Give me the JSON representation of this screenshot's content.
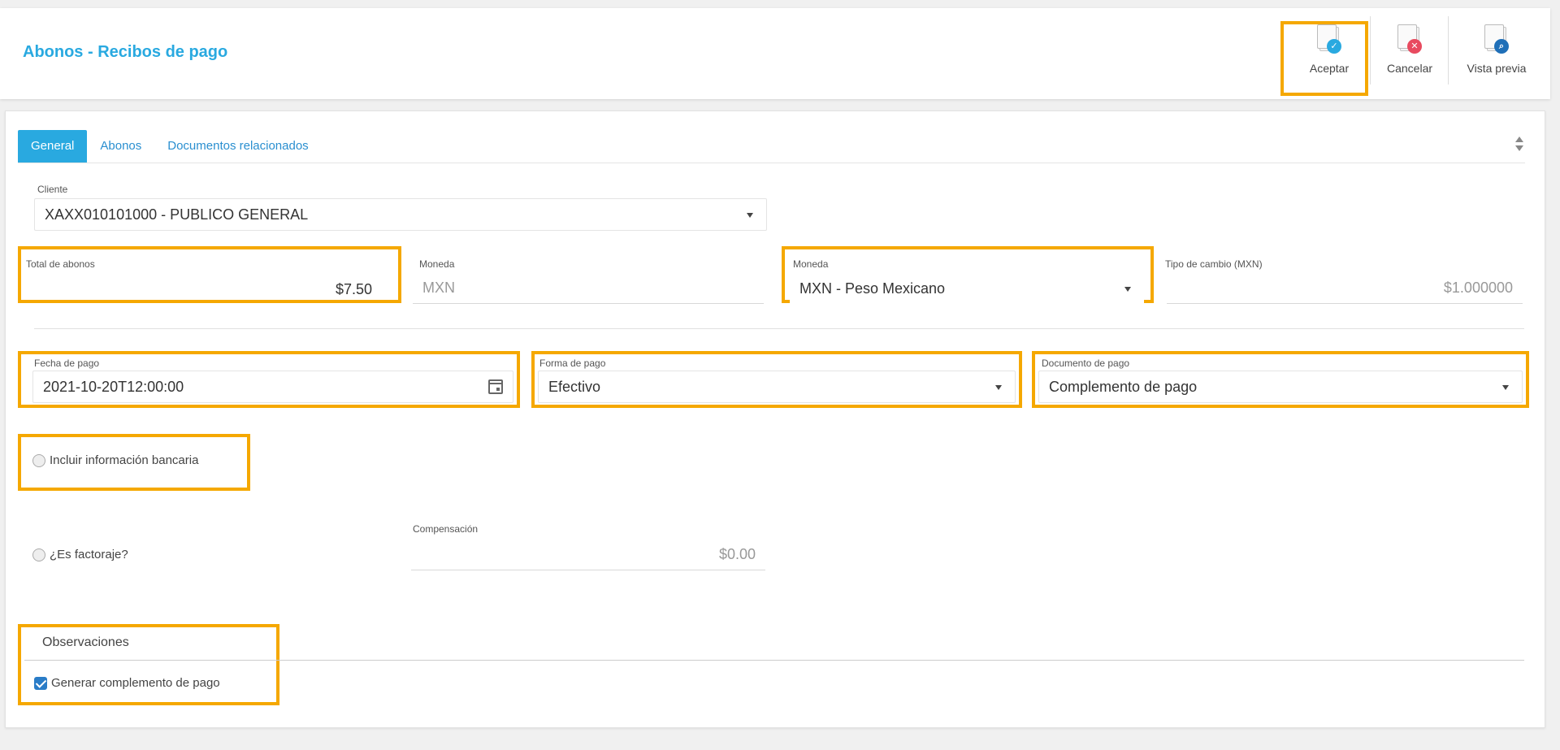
{
  "header": {
    "title": "Abonos - Recibos de pago",
    "actions": [
      {
        "label": "Aceptar",
        "icon": "document-accept-icon",
        "color": "#29a9e0"
      },
      {
        "label": "Cancelar",
        "icon": "document-cancel-icon",
        "color": "#e84a5f"
      },
      {
        "label": "Vista previa",
        "icon": "document-preview-icon",
        "color": "#1f6fb8"
      }
    ]
  },
  "tabs": [
    {
      "label": "General",
      "active": true
    },
    {
      "label": "Abonos",
      "active": false
    },
    {
      "label": "Documentos relacionados",
      "active": false
    }
  ],
  "form": {
    "cliente": {
      "label": "Cliente",
      "value": "XAXX010101000 - PUBLICO GENERAL"
    },
    "total_abonos": {
      "label": "Total de abonos",
      "value": "$7.50"
    },
    "moneda_ro": {
      "label": "Moneda",
      "value": "MXN"
    },
    "moneda": {
      "label": "Moneda",
      "value": "MXN - Peso Mexicano"
    },
    "tipo_cambio": {
      "label": "Tipo de cambio (MXN)",
      "value": "$1.000000"
    },
    "fecha_pago": {
      "label": "Fecha de pago",
      "value": "2021-10-20T12:00:00"
    },
    "forma_pago": {
      "label": "Forma de pago",
      "value": "Efectivo"
    },
    "documento_pago": {
      "label": "Documento de pago",
      "value": "Complemento de pago"
    },
    "incluir_bancaria": {
      "label": "Incluir información bancaria",
      "checked": false
    },
    "factoraje": {
      "label": "¿Es factoraje?",
      "checked": false
    },
    "compensacion": {
      "label": "Compensación",
      "value": "$0.00"
    },
    "observaciones": {
      "label": "Observaciones"
    },
    "generar_complemento": {
      "label": "Generar complemento de pago",
      "checked": true
    }
  },
  "colors": {
    "accent": "#29a9e0",
    "highlight": "#f5a800"
  }
}
